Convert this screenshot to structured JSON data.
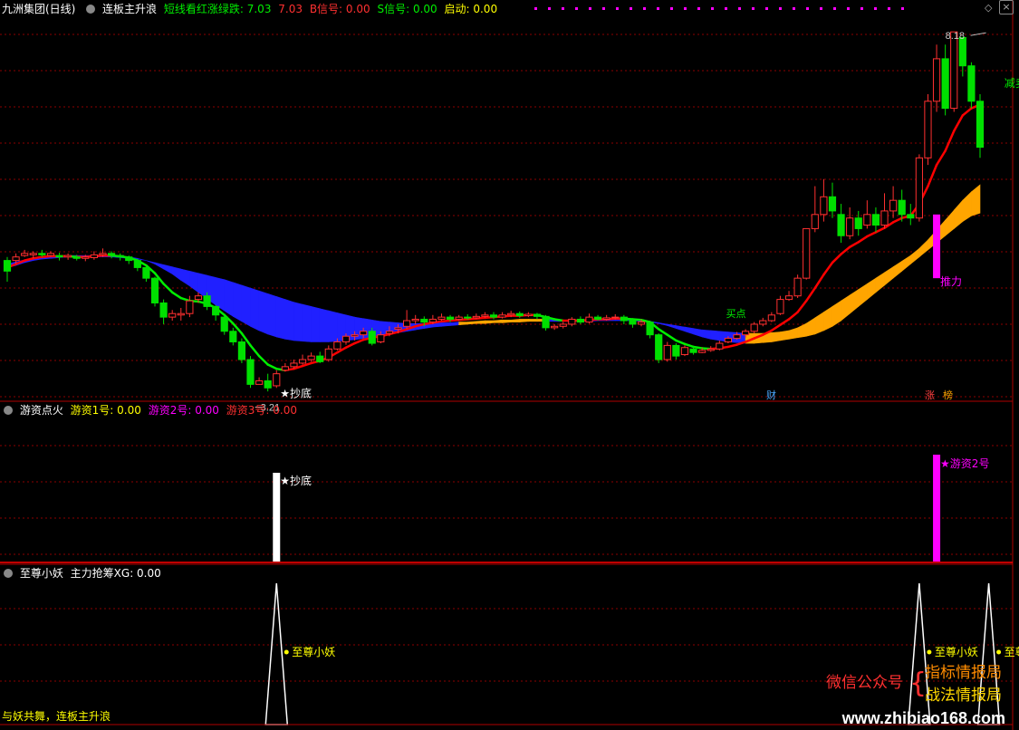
{
  "colors": {
    "up": "#ff3030",
    "down": "#00e000",
    "ma_red": "#ff0000",
    "ma_green": "#00ee00",
    "band_blue": "#2020ff",
    "band_orange": "#ffa500",
    "magenta": "#ff00ff",
    "grid": "#8b0000",
    "white": "#ffffff",
    "yellow": "#ffff00",
    "text_gray": "#cccccc"
  },
  "main_panel": {
    "stock_name": "九洲集团(日线)",
    "indicator_name": "连板主升浪",
    "short_line_label": "短线看红涨绿跌: 7.03",
    "value_2": "7.03",
    "b_signal": "B信号: 0.00",
    "s_signal": "S信号: 0.00",
    "start_signal": "启动: 0.00",
    "annotations": {
      "high_value": "8.18",
      "low_value": "3.21",
      "bottom_label": "★抄底",
      "push_label": "推力",
      "sell_label": "减卖",
      "buy_label": "买点",
      "cai_badge": "财",
      "zhang_badge": "涨",
      "bang_badge": "榜"
    }
  },
  "panel2": {
    "title": "游资点火",
    "s1": "游资1号: 0.00",
    "s2": "游资2号: 0.00",
    "s3": "游资3号: 0.00",
    "bottom_label": "★抄底",
    "youzi2_label": "★游资2号"
  },
  "panel3": {
    "title": "至尊小妖",
    "signal": "主力抢筹XG: 0.00",
    "peak_label": "至尊小妖",
    "footer": "与妖共舞，连板主升浪"
  },
  "watermark": {
    "wechat": "微信公众号",
    "name1": "指标情报局",
    "name2": "战法情报局",
    "url": "www.zhibiao168.com"
  },
  "chart_data": {
    "type": "candlestick",
    "price_range": [
      3.0,
      8.4
    ],
    "candles": [
      [
        4.95,
        4.8,
        5.0,
        4.65
      ],
      [
        4.95,
        5.0,
        5.05,
        4.9
      ],
      [
        5.02,
        5.05,
        5.1,
        5.0
      ],
      [
        5.03,
        5.05,
        5.08,
        4.98
      ],
      [
        5.05,
        5.03,
        5.1,
        5.0
      ],
      [
        5.02,
        5.05,
        5.08,
        5.0
      ],
      [
        5.02,
        5.0,
        5.06,
        4.95
      ],
      [
        5.0,
        5.02,
        5.05,
        4.96
      ],
      [
        5.0,
        4.98,
        5.03,
        4.95
      ],
      [
        4.98,
        5.0,
        5.03,
        4.94
      ],
      [
        4.99,
        5.03,
        5.08,
        4.96
      ],
      [
        5.03,
        5.05,
        5.12,
        5.0
      ],
      [
        5.05,
        5.02,
        5.08,
        4.98
      ],
      [
        5.02,
        5.0,
        5.05,
        4.95
      ],
      [
        5.0,
        4.95,
        5.02,
        4.9
      ],
      [
        4.95,
        4.85,
        4.97,
        4.8
      ],
      [
        4.85,
        4.7,
        4.88,
        4.65
      ],
      [
        4.7,
        4.35,
        4.72,
        4.3
      ],
      [
        4.35,
        4.15,
        4.4,
        4.05
      ],
      [
        4.15,
        4.2,
        4.25,
        4.1
      ],
      [
        4.18,
        4.2,
        4.28,
        4.1
      ],
      [
        4.2,
        4.38,
        4.45,
        4.15
      ],
      [
        4.4,
        4.45,
        4.5,
        4.35
      ],
      [
        4.45,
        4.3,
        4.5,
        4.25
      ],
      [
        4.3,
        4.18,
        4.32,
        4.1
      ],
      [
        4.15,
        3.95,
        4.2,
        3.9
      ],
      [
        3.95,
        3.8,
        4.0,
        3.75
      ],
      [
        3.8,
        3.55,
        3.85,
        3.5
      ],
      [
        3.55,
        3.2,
        3.6,
        3.15
      ],
      [
        3.2,
        3.25,
        3.3,
        3.21
      ],
      [
        3.25,
        3.15,
        3.35,
        3.1
      ],
      [
        3.18,
        3.35,
        3.4,
        3.15
      ],
      [
        3.4,
        3.45,
        3.5,
        3.38
      ],
      [
        3.45,
        3.5,
        3.55,
        3.42
      ],
      [
        3.5,
        3.55,
        3.62,
        3.48
      ],
      [
        3.55,
        3.6,
        3.65,
        3.52
      ],
      [
        3.6,
        3.52,
        3.66,
        3.5
      ],
      [
        3.55,
        3.7,
        3.75,
        3.52
      ],
      [
        3.7,
        3.8,
        3.85,
        3.68
      ],
      [
        3.8,
        3.88,
        3.92,
        3.76
      ],
      [
        3.88,
        3.9,
        3.95,
        3.82
      ],
      [
        3.9,
        3.95,
        4.0,
        3.85
      ],
      [
        3.95,
        3.78,
        4.0,
        3.75
      ],
      [
        3.8,
        3.9,
        3.95,
        3.78
      ],
      [
        3.92,
        3.95,
        4.02,
        3.88
      ],
      [
        3.98,
        4.0,
        4.05,
        3.92
      ],
      [
        4.02,
        4.1,
        4.25,
        3.98
      ],
      [
        4.1,
        4.12,
        4.18,
        4.05
      ],
      [
        4.12,
        4.08,
        4.16,
        4.02
      ],
      [
        4.08,
        4.12,
        4.18,
        4.05
      ],
      [
        4.12,
        4.15,
        4.2,
        4.1
      ],
      [
        4.15,
        4.12,
        4.18,
        4.08
      ],
      [
        4.12,
        4.15,
        4.18,
        4.1
      ],
      [
        4.15,
        4.14,
        4.19,
        4.11
      ],
      [
        4.14,
        4.16,
        4.2,
        4.12
      ],
      [
        4.16,
        4.18,
        4.22,
        4.14
      ],
      [
        4.18,
        4.15,
        4.22,
        4.12
      ],
      [
        4.15,
        4.18,
        4.22,
        4.13
      ],
      [
        4.18,
        4.2,
        4.24,
        4.15
      ],
      [
        4.2,
        4.17,
        4.23,
        4.14
      ],
      [
        4.17,
        4.19,
        4.22,
        4.15
      ],
      [
        4.19,
        4.16,
        4.21,
        4.12
      ],
      [
        4.16,
        4.0,
        4.18,
        3.96
      ],
      [
        4.0,
        4.02,
        4.05,
        3.97
      ],
      [
        4.02,
        4.05,
        4.08,
        3.99
      ],
      [
        4.05,
        4.12,
        4.15,
        4.02
      ],
      [
        4.12,
        4.08,
        4.16,
        4.05
      ],
      [
        4.08,
        4.15,
        4.2,
        4.06
      ],
      [
        4.15,
        4.12,
        4.18,
        4.1
      ],
      [
        4.12,
        4.14,
        4.18,
        4.1
      ],
      [
        4.14,
        4.15,
        4.19,
        4.12
      ],
      [
        4.15,
        4.1,
        4.18,
        4.05
      ],
      [
        4.1,
        4.05,
        4.12,
        4.0
      ],
      [
        4.05,
        4.08,
        4.12,
        4.02
      ],
      [
        4.08,
        3.9,
        4.1,
        3.85
      ],
      [
        3.9,
        3.55,
        3.92,
        3.5
      ],
      [
        3.55,
        3.75,
        3.8,
        3.52
      ],
      [
        3.75,
        3.6,
        3.78,
        3.55
      ],
      [
        3.62,
        3.72,
        3.75,
        3.6
      ],
      [
        3.7,
        3.65,
        3.73,
        3.62
      ],
      [
        3.65,
        3.68,
        3.72,
        3.64
      ],
      [
        3.68,
        3.7,
        3.74,
        3.66
      ],
      [
        3.7,
        3.78,
        3.82,
        3.68
      ],
      [
        3.8,
        3.85,
        3.88,
        3.78
      ],
      [
        3.85,
        3.9,
        3.94,
        3.83
      ],
      [
        3.9,
        3.95,
        3.98,
        3.86
      ],
      [
        3.95,
        4.05,
        4.08,
        3.92
      ],
      [
        4.05,
        4.1,
        4.14,
        4.02
      ],
      [
        4.1,
        4.18,
        4.22,
        4.08
      ],
      [
        4.2,
        4.4,
        4.45,
        4.18
      ],
      [
        4.4,
        4.45,
        4.52,
        4.38
      ],
      [
        4.45,
        4.7,
        4.75,
        4.42
      ],
      [
        4.7,
        5.4,
        5.4,
        4.68
      ],
      [
        5.4,
        5.6,
        6.0,
        5.35
      ],
      [
        5.6,
        5.85,
        6.1,
        5.5
      ],
      [
        5.85,
        5.65,
        6.05,
        5.55
      ],
      [
        5.6,
        5.3,
        5.75,
        5.2
      ],
      [
        5.3,
        5.55,
        5.7,
        5.25
      ],
      [
        5.55,
        5.4,
        5.65,
        5.3
      ],
      [
        5.45,
        5.6,
        5.8,
        5.4
      ],
      [
        5.6,
        5.45,
        5.7,
        5.35
      ],
      [
        5.45,
        5.65,
        5.9,
        5.4
      ],
      [
        5.65,
        5.8,
        6.0,
        5.55
      ],
      [
        5.8,
        5.6,
        5.95,
        5.5
      ],
      [
        5.6,
        5.55,
        5.75,
        5.45
      ],
      [
        5.55,
        6.4,
        6.45,
        5.5
      ],
      [
        6.4,
        7.2,
        7.3,
        6.3
      ],
      [
        7.2,
        7.8,
        8.0,
        7.05
      ],
      [
        7.8,
        7.1,
        8.0,
        7.0
      ],
      [
        7.1,
        8.18,
        8.18,
        7.05
      ],
      [
        8.1,
        7.7,
        8.1,
        7.55
      ],
      [
        7.7,
        7.2,
        7.75,
        7.1
      ],
      [
        7.2,
        6.55,
        7.3,
        6.4
      ]
    ],
    "series": [
      {
        "name": "连板主升浪",
        "values": [
          4.85,
          4.9,
          4.95,
          4.98,
          5.0,
          5.01,
          5.01,
          5.01,
          5.0,
          5.0,
          5.01,
          5.02,
          5.02,
          5.01,
          4.99,
          4.95,
          4.88,
          4.77,
          4.62,
          4.5,
          4.42,
          4.38,
          4.37,
          4.34,
          4.28,
          4.18,
          4.06,
          3.92,
          3.75,
          3.6,
          3.48,
          3.42,
          3.4,
          3.42,
          3.46,
          3.5,
          3.53,
          3.58,
          3.65,
          3.72,
          3.78,
          3.83,
          3.86,
          3.88,
          3.91,
          3.94,
          3.98,
          4.02,
          4.05,
          4.07,
          4.09,
          4.1,
          4.11,
          4.12,
          4.13,
          4.14,
          4.15,
          4.16,
          4.17,
          4.17,
          4.18,
          4.18,
          4.15,
          4.12,
          4.1,
          4.1,
          4.1,
          4.11,
          4.12,
          4.12,
          4.13,
          4.13,
          4.12,
          4.11,
          4.08,
          3.98,
          3.9,
          3.82,
          3.77,
          3.73,
          3.71,
          3.7,
          3.71,
          3.73,
          3.76,
          3.8,
          3.85,
          3.9,
          3.96,
          4.04,
          4.12,
          4.22,
          4.38,
          4.56,
          4.75,
          4.92,
          5.04,
          5.14,
          5.21,
          5.29,
          5.35,
          5.41,
          5.49,
          5.55,
          5.58,
          5.75,
          6.0,
          6.3,
          6.5,
          6.78,
          7.0,
          7.1,
          7.15
        ]
      },
      {
        "name": "band_upper",
        "values": [
          4.9,
          4.93,
          4.96,
          4.98,
          5.0,
          5.01,
          5.02,
          5.02,
          5.02,
          5.02,
          5.02,
          5.02,
          5.02,
          5.01,
          5.0,
          4.98,
          4.95,
          4.92,
          4.89,
          4.86,
          4.83,
          4.8,
          4.77,
          4.74,
          4.71,
          4.68,
          4.64,
          4.6,
          4.56,
          4.52,
          4.48,
          4.44,
          4.4,
          4.36,
          4.33,
          4.3,
          4.27,
          4.24,
          4.21,
          4.18,
          4.15,
          4.13,
          4.11,
          4.09,
          4.08,
          4.07,
          4.06,
          4.06,
          4.06,
          4.06,
          4.07,
          4.07,
          4.08,
          4.08,
          4.09,
          4.1,
          4.1,
          4.11,
          4.11,
          4.12,
          4.12,
          4.12,
          4.12,
          4.11,
          4.11,
          4.11,
          4.11,
          4.11,
          4.11,
          4.11,
          4.11,
          4.11,
          4.1,
          4.1,
          4.09,
          4.07,
          4.05,
          4.03,
          4.01,
          3.99,
          3.97,
          3.96,
          3.95,
          3.94,
          3.93,
          3.92,
          3.92,
          3.92,
          3.93,
          3.94,
          3.96,
          4.0,
          4.06,
          4.14,
          4.22,
          4.3,
          4.38,
          4.46,
          4.54,
          4.62,
          4.7,
          4.78,
          4.86,
          4.94,
          5.02,
          5.12,
          5.24,
          5.38,
          5.52,
          5.66,
          5.8,
          5.92,
          6.02
        ]
      },
      {
        "name": "band_lower",
        "values": [
          4.85,
          4.88,
          4.92,
          4.95,
          4.97,
          4.98,
          4.99,
          5.0,
          5.0,
          5.0,
          5.0,
          5.0,
          5.0,
          4.99,
          4.98,
          4.97,
          4.95,
          4.9,
          4.83,
          4.76,
          4.67,
          4.59,
          4.5,
          4.41,
          4.32,
          4.24,
          4.16,
          4.09,
          4.02,
          3.96,
          3.91,
          3.87,
          3.84,
          3.82,
          3.81,
          3.8,
          3.8,
          3.8,
          3.81,
          3.82,
          3.83,
          3.85,
          3.87,
          3.89,
          3.91,
          3.93,
          3.95,
          3.97,
          3.99,
          4.01,
          4.02,
          4.03,
          4.04,
          4.05,
          4.06,
          4.06,
          4.07,
          4.07,
          4.08,
          4.08,
          4.09,
          4.09,
          4.09,
          4.09,
          4.09,
          4.09,
          4.09,
          4.09,
          4.1,
          4.1,
          4.1,
          4.1,
          4.1,
          4.09,
          4.08,
          4.06,
          4.03,
          3.99,
          3.95,
          3.91,
          3.87,
          3.84,
          3.82,
          3.8,
          3.79,
          3.78,
          3.78,
          3.79,
          3.8,
          3.82,
          3.84,
          3.86,
          3.88,
          3.91,
          3.96,
          4.02,
          4.1,
          4.2,
          4.3,
          4.4,
          4.5,
          4.6,
          4.7,
          4.8,
          4.9,
          5.0,
          5.1,
          5.2,
          5.3,
          5.4,
          5.5,
          5.58,
          5.62
        ]
      }
    ],
    "panel2_bars": [
      {
        "index": 31,
        "value": 1.0,
        "color": "white"
      },
      {
        "index": 107,
        "value": 1.0,
        "color": "magenta"
      }
    ],
    "panel3_peaks": [
      31,
      105,
      113
    ],
    "grid": true
  }
}
